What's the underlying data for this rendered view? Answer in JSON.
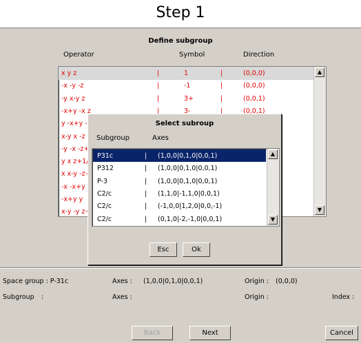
{
  "step_title": "Step 1",
  "panel_title": "Define subgroup",
  "columns": {
    "operator": "Operator",
    "symbol": "Symbol",
    "direction": "Direction"
  },
  "operators": [
    {
      "op": "x y z",
      "symbol": "1",
      "direction": "(0,0,0)"
    },
    {
      "op": "-x -y -z",
      "symbol": "-1",
      "direction": "(0,0,0)"
    },
    {
      "op": "-y x-y z",
      "symbol": "3+",
      "direction": "(0,0,1)"
    },
    {
      "op": "-x+y -x z",
      "symbol": "3-",
      "direction": "(0,0,1)"
    },
    {
      "op": "y -x+y -",
      "symbol": "",
      "direction": ""
    },
    {
      "op": "x-y x -z",
      "symbol": "",
      "direction": ""
    },
    {
      "op": "-y -x -z+",
      "symbol": "",
      "direction": ""
    },
    {
      "op": "y x z+1/",
      "symbol": "",
      "direction": ""
    },
    {
      "op": "x x-y -z+",
      "symbol": "",
      "direction": ""
    },
    {
      "op": "-x -x+y",
      "symbol": "",
      "direction": ""
    },
    {
      "op": "-x+y y",
      "symbol": "",
      "direction": ""
    },
    {
      "op": "x-y -y z+",
      "symbol": "",
      "direction": ""
    }
  ],
  "dialog": {
    "title": "Select subroup",
    "col_subgroup": "Subgroup",
    "col_axes": "Axes",
    "rows": [
      {
        "name": "P31c",
        "axes": "(1,0,0|0,1,0|0,0,1)"
      },
      {
        "name": "P312",
        "axes": "(1,0,0|0,1,0|0,0,1)"
      },
      {
        "name": "P-3",
        "axes": "(1,0,0|0,1,0|0,0,1)"
      },
      {
        "name": "C2/c",
        "axes": "(1,1,0|-1,1,0|0,0,1)"
      },
      {
        "name": "C2/c",
        "axes": "(-1,0,0|1,2,0|0,0,-1)"
      },
      {
        "name": "C2/c",
        "axes": "(0,1,0|-2,-1,0|0,0,1)"
      }
    ],
    "esc_label": "Esc",
    "ok_label": "Ok"
  },
  "info": {
    "space_group_label": "Space group : P-31c",
    "axes_label_1": "Axes :",
    "axes_value_1": "(1,0,0|0,1,0|0,0,1)",
    "origin_label_1": "Origin :",
    "origin_value_1": "(0,0,0)",
    "subgroup_label": "Subgroup",
    "subgroup_colon": ":",
    "axes_label_2": "Axes :",
    "origin_label_2": "Origin :",
    "index_label": "Index :"
  },
  "buttons": {
    "back": "Back",
    "next": "Next",
    "cancel": "Cancel"
  },
  "separator_char": "|",
  "scroll_up_icon": "▲",
  "scroll_down_icon": "▼",
  "colors": {
    "operator_text": "#e00000",
    "selection": "#0a246a",
    "panel_bg": "#d4d0c8"
  }
}
